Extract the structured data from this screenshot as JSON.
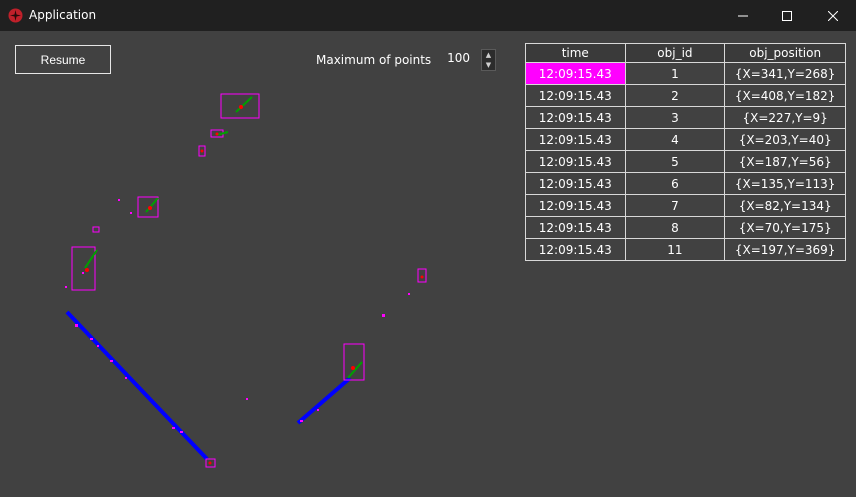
{
  "window": {
    "title": "Application",
    "icon": "app-logo-icon",
    "controls": [
      "minimize-icon",
      "maximize-icon",
      "close-icon"
    ]
  },
  "controls": {
    "resume_label": "Resume",
    "max_points_label": "Maximum of points",
    "max_points_value": "100"
  },
  "table": {
    "headers": [
      "time",
      "obj_id",
      "obj_position"
    ],
    "rows": [
      {
        "time": "12:09:15.43",
        "obj_id": "1",
        "obj_position": "{X=341,Y=268}"
      },
      {
        "time": "12:09:15.43",
        "obj_id": "2",
        "obj_position": "{X=408,Y=182}"
      },
      {
        "time": "12:09:15.43",
        "obj_id": "3",
        "obj_position": "{X=227,Y=9}"
      },
      {
        "time": "12:09:15.43",
        "obj_id": "4",
        "obj_position": "{X=203,Y=40}"
      },
      {
        "time": "12:09:15.43",
        "obj_id": "5",
        "obj_position": "{X=187,Y=56}"
      },
      {
        "time": "12:09:15.43",
        "obj_id": "6",
        "obj_position": "{X=135,Y=113}"
      },
      {
        "time": "12:09:15.43",
        "obj_id": "7",
        "obj_position": "{X=82,Y=134}"
      },
      {
        "time": "12:09:15.43",
        "obj_id": "8",
        "obj_position": "{X=70,Y=175}"
      },
      {
        "time": "12:09:15.43",
        "obj_id": "11",
        "obj_position": "{X=197,Y=369}"
      }
    ],
    "highlight_color": "#ff00ff"
  },
  "colors": {
    "background": "#414141",
    "titlebar": "#202020",
    "points": "#ff00ff",
    "lines": "#0000ff",
    "direction": "#00a000",
    "centroid": "#ff0000"
  }
}
